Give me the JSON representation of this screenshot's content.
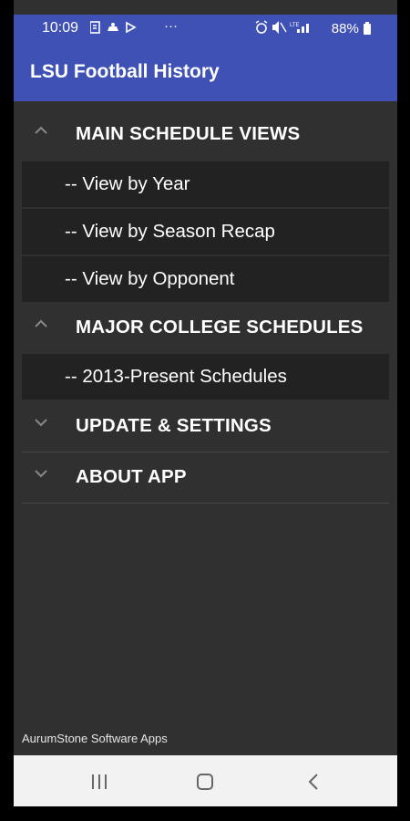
{
  "status_bar": {
    "time": "10:09",
    "battery": "88%",
    "left_icons_more": "···"
  },
  "app_bar": {
    "title": "LSU Football History"
  },
  "menu": {
    "groups": [
      {
        "label": "MAIN SCHEDULE VIEWS",
        "expanded": true,
        "items": [
          {
            "label": "-- View by Year"
          },
          {
            "label": "-- View by Season Recap"
          },
          {
            "label": "-- View by Opponent"
          }
        ]
      },
      {
        "label": "MAJOR COLLEGE SCHEDULES",
        "expanded": true,
        "items": [
          {
            "label": "-- 2013-Present Schedules"
          }
        ]
      },
      {
        "label": "UPDATE & SETTINGS",
        "expanded": false,
        "items": []
      },
      {
        "label": "ABOUT APP",
        "expanded": false,
        "items": []
      }
    ]
  },
  "footer": {
    "text": "AurumStone Software Apps"
  },
  "colors": {
    "primary": "#3f51b5",
    "background": "#303030",
    "child_bg": "#222222"
  }
}
